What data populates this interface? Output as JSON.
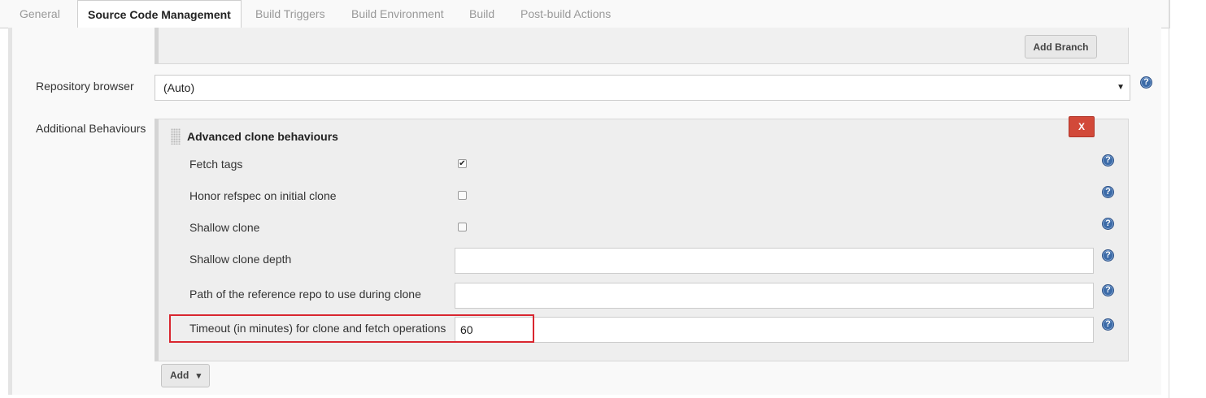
{
  "tabs": [
    {
      "label": "General"
    },
    {
      "label": "Source Code Management"
    },
    {
      "label": "Build Triggers"
    },
    {
      "label": "Build Environment"
    },
    {
      "label": "Build"
    },
    {
      "label": "Post-build Actions"
    }
  ],
  "branches": {
    "add_branch_label": "Add Branch"
  },
  "repository_browser": {
    "label": "Repository browser",
    "selected": "(Auto)",
    "arrow": "▼"
  },
  "additional_behaviours": {
    "label": "Additional Behaviours",
    "section_title": "Advanced clone behaviours",
    "delete_label": "X",
    "options": [
      {
        "label": "Fetch tags",
        "checked": true
      },
      {
        "label": "Honor refspec on initial clone",
        "checked": false
      },
      {
        "label": "Shallow clone",
        "checked": false
      }
    ],
    "fields": [
      {
        "label": "Shallow clone depth",
        "value": ""
      },
      {
        "label": "Path of the reference repo to use during clone",
        "value": ""
      },
      {
        "label": "Timeout (in minutes) for clone and fetch operations",
        "value": "60"
      }
    ],
    "add_label": "Add",
    "add_arrow": "▾"
  },
  "help_glyph": "?",
  "check_glyph": "✔"
}
